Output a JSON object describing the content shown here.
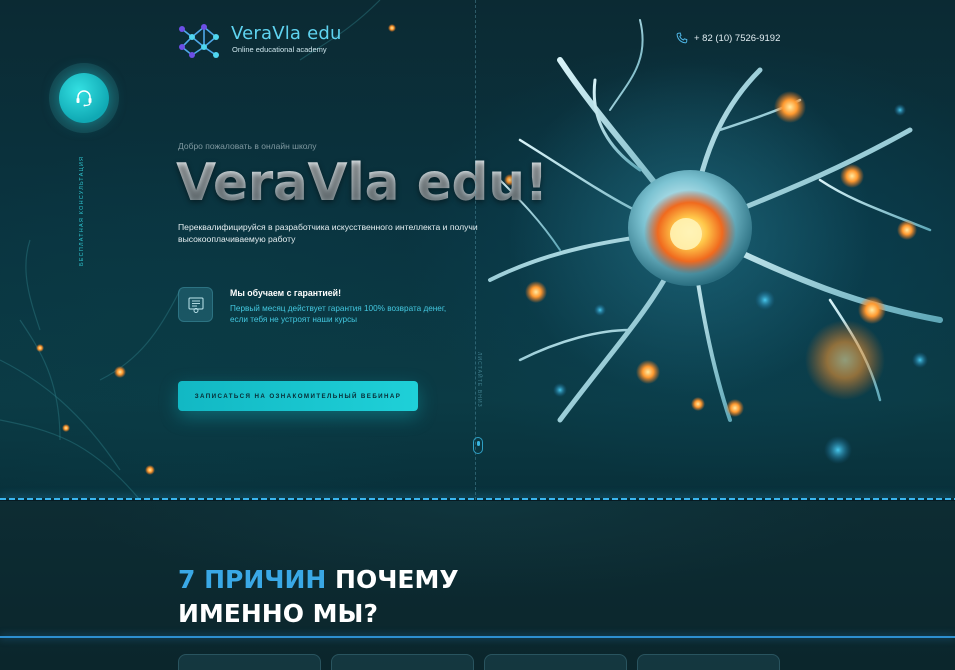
{
  "header": {
    "logo_title": "VeraVla edu",
    "logo_subtitle": "Online educational academy",
    "phone": "+ 82 (10) 7526-9192"
  },
  "consult": {
    "label": "бесплатная консультация"
  },
  "hero": {
    "welcome": "Добро пожаловать в онлайн школу",
    "title": "VeraVla edu!",
    "subtitle": "Переквалифицируйся в разработчика искусственного интеллекта и получи высокооплачиваемую работу",
    "guarantee_title": "Мы обучаем с гарантией!",
    "guarantee_text": "Первый месяц действует гарантия 100% возврата денег, если тебя не устроят наши курсы",
    "cta_label": "Записаться на ознакомительный вебинар",
    "scroll_label": "листайте вниз"
  },
  "reasons": {
    "title_accent": "7 ПРИЧИН",
    "title_rest": " ПОЧЕМУ",
    "title_line2": "ИМЕННО МЫ?"
  },
  "icons": {
    "logo": "neural-network-logo",
    "phone": "phone-icon",
    "consult": "headset-icon",
    "guarantee": "certificate-icon",
    "scroll": "mouse-scroll-icon"
  },
  "colors": {
    "accent_cyan": "#1fd0d8",
    "accent_blue": "#3aa8e6",
    "background": "#0b2a33"
  }
}
